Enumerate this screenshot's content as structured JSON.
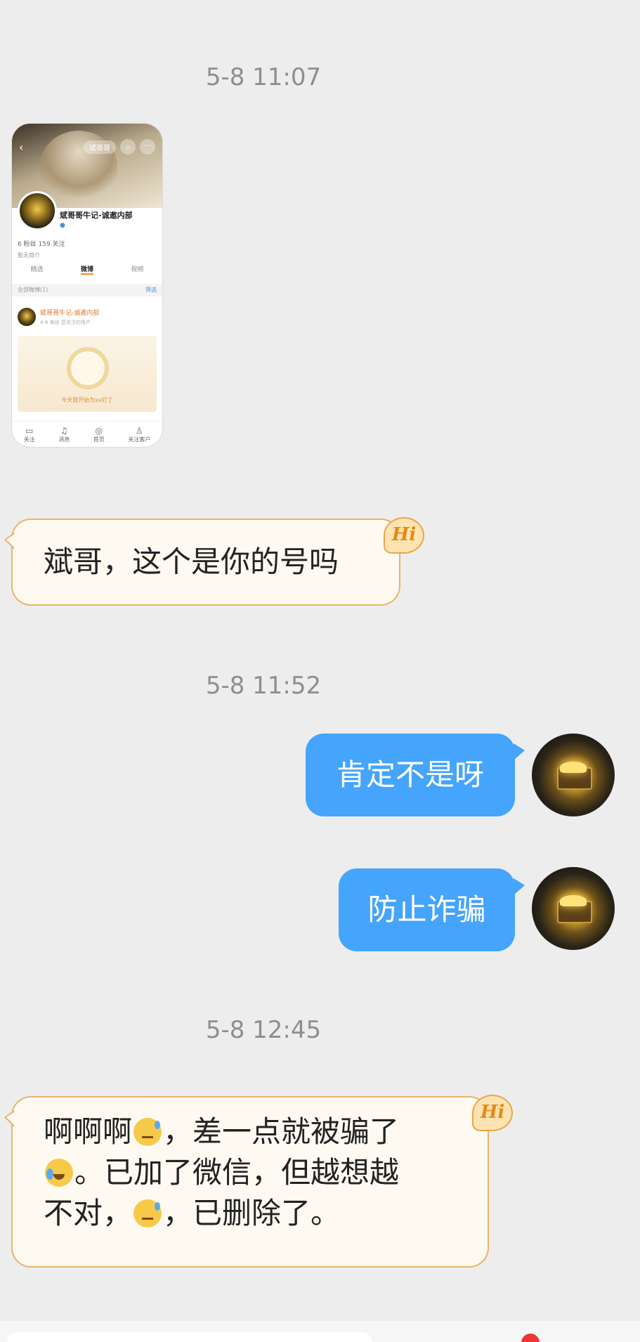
{
  "messages": {
    "ts1": "5-8 11:07",
    "ts2": "5-8 11:52",
    "ts3": "5-8 12:45",
    "m1": "斌哥，这个是你的号吗",
    "m2": "肯定不是呀",
    "m3": "防止诈骗",
    "m4_a": "啊啊啊",
    "m4_b": "，差一点就被骗了",
    "m4_c": "。已加了微信，但越想越",
    "m4_d": "不对，",
    "m4_e": "，已删除了。",
    "hi": "Hi"
  },
  "screenshot": {
    "pill": "斌哥哥",
    "name": "斌哥哥牛记-诚邀内部",
    "stats": "6 粉丝  159 关注",
    "intro": "暂无简介",
    "tabs": [
      "精选",
      "微博",
      "视频"
    ],
    "filter_left": "全部微博(1)",
    "filter_right": "筛选",
    "post_name": "斌哥哥牛记-诚邀内部",
    "post_time": "4-6 来自 您关注的用户",
    "card_text": "今天我开始为xx打了",
    "bottom": [
      "关注",
      "消息",
      "首页",
      "关注客户"
    ]
  },
  "colors": {
    "background": "#ededed",
    "incoming_bubble": "#fffaf1",
    "incoming_border": "#e8b46a",
    "outgoing_bubble": "#45a4fb",
    "timestamp": "#8e8e8e"
  },
  "icons": [
    "hi-badge-icon",
    "sweat-emoji-icon",
    "crying-laughing-emoji-icon",
    "treasure-chest-avatar"
  ]
}
